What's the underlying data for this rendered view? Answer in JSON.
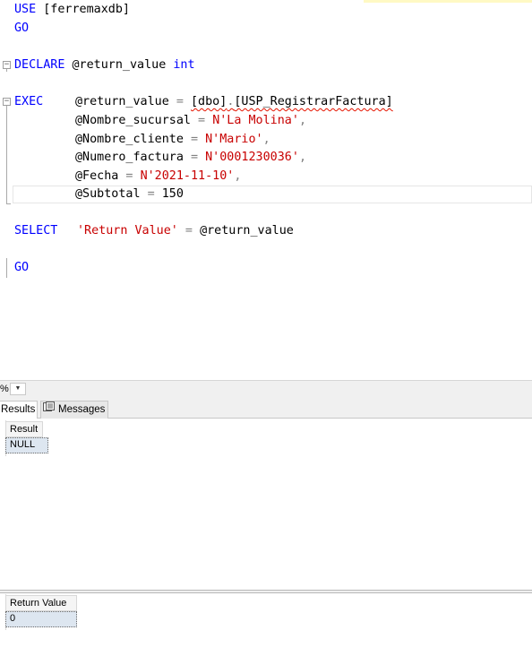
{
  "editor": {
    "lines": {
      "use_kw": "USE",
      "use_db": " [ferremaxdb]",
      "go1": "GO",
      "declare_kw": "DECLARE",
      "declare_var": " @return_value ",
      "declare_type": "int",
      "exec_kw": "EXEC",
      "exec_var": "@return_value",
      "exec_eq": " = ",
      "exec_schema": "[dbo]",
      "exec_dot": ".",
      "exec_proc": "[USP_RegistrarFactura]",
      "p1_name": "@Nombre_sucursal",
      "p1_eq": " = ",
      "p1_val": "N'La Molina'",
      "p1_comma": ",",
      "p2_name": "@Nombre_cliente",
      "p2_eq": " = ",
      "p2_val": "N'Mario'",
      "p2_comma": ",",
      "p3_name": "@Numero_factura",
      "p3_eq": " = ",
      "p3_val": "N'0001230036'",
      "p3_comma": ",",
      "p4_name": "@Fecha",
      "p4_eq": " = ",
      "p4_val": "N'2021-11-10'",
      "p4_comma": ",",
      "p5_name": "@Subtotal",
      "p5_eq": " = ",
      "p5_val": "150",
      "select_kw": "SELECT",
      "select_str": "'Return Value'",
      "select_eq": " = ",
      "select_var": "@return_value",
      "go2": "GO"
    },
    "colors": {
      "keyword": "#0000ff",
      "string": "#c80000",
      "operator": "#808080",
      "error_squiggle": "#e51400"
    }
  },
  "zoom": {
    "value": "%"
  },
  "tabs": {
    "results": "Results",
    "messages": "Messages"
  },
  "results": [
    {
      "column": "Result",
      "value": "NULL"
    },
    {
      "column": "Return Value",
      "value": "0"
    }
  ]
}
